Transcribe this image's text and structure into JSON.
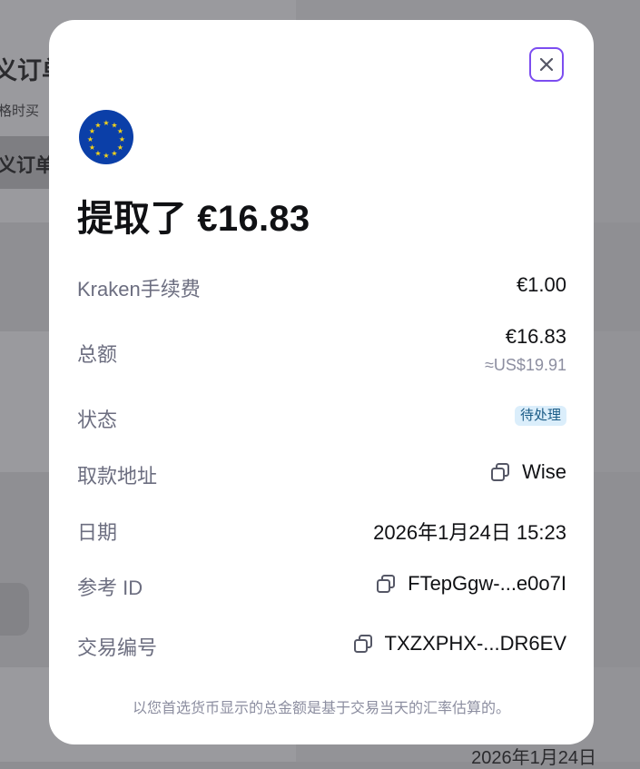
{
  "background": {
    "title_fragment": "义订单",
    "subtitle_fragment": "格时买",
    "button_fragment": "义订单",
    "date_fragment": "2026年1月24日"
  },
  "modal": {
    "title": "提取了 €16.83",
    "close_icon": "close-icon",
    "flag_icon": "eu-flag-icon",
    "rows": {
      "fee": {
        "label": "Kraken手续费",
        "value": "€1.00"
      },
      "total": {
        "label": "总额",
        "value": "€16.83",
        "sub_value": "≈US$19.91"
      },
      "status": {
        "label": "状态",
        "value": "待处理"
      },
      "address": {
        "label": "取款地址",
        "value": "Wise"
      },
      "date": {
        "label": "日期",
        "value": "2026年1月24日 15:23"
      },
      "ref_id": {
        "label": "参考 ID",
        "value": "FTepGgw-...e0o7I"
      },
      "tx_id": {
        "label": "交易编号",
        "value": "TXZXPHX-...DR6EV"
      }
    },
    "footnote": "以您首选货币显示的总金额是基于交易当天的汇率估算的。"
  },
  "colors": {
    "accent": "#7c4df0",
    "label": "#6c6e80",
    "badge_bg": "#dbeefb",
    "badge_text": "#1a5b86",
    "flag_blue": "#0b3fa8",
    "flag_star": "#f5d319"
  }
}
